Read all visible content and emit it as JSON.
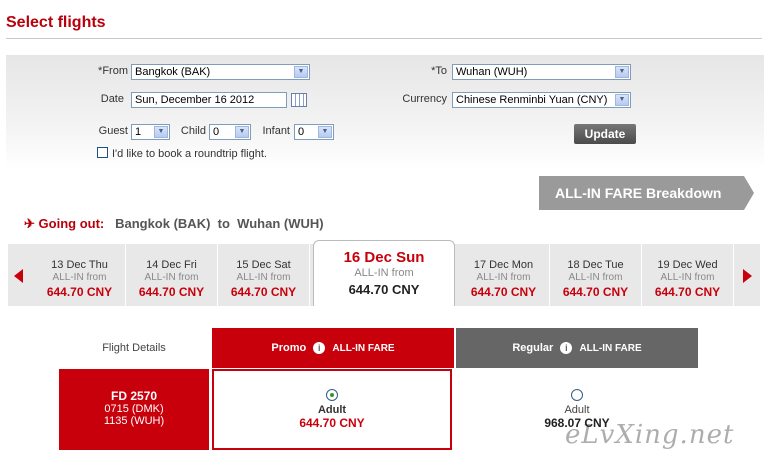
{
  "page": {
    "title": "Select flights"
  },
  "search": {
    "from_label": "*From",
    "from_value": "Bangkok (BAK)",
    "to_label": "*To",
    "to_value": "Wuhan (WUH)",
    "date_label": "Date",
    "date_value": "Sun, December 16 2012",
    "currency_label": "Currency",
    "currency_value": "Chinese Renminbi Yuan (CNY)",
    "guest_label": "Guest",
    "guest_value": "1",
    "child_label": "Child",
    "child_value": "0",
    "infant_label": "Infant",
    "infant_value": "0",
    "roundtrip_label": "I'd like to book a roundtrip flight.",
    "roundtrip_checked": false,
    "update_label": "Update"
  },
  "breakdown_label": "ALL-IN FARE Breakdown",
  "going_out": {
    "label": "Going out:",
    "from": "Bangkok (BAK)",
    "connector": "to",
    "to": "Wuhan (WUH)"
  },
  "date_strip": {
    "days": [
      {
        "date": "13 Dec Thu",
        "sub": "ALL-IN from",
        "price": "644.70 CNY"
      },
      {
        "date": "14 Dec Fri",
        "sub": "ALL-IN from",
        "price": "644.70 CNY"
      },
      {
        "date": "15 Dec Sat",
        "sub": "ALL-IN from",
        "price": "644.70 CNY"
      },
      {
        "date": "16 Dec Sun",
        "sub": "ALL-IN from",
        "price": "644.70 CNY",
        "selected": true
      },
      {
        "date": "17 Dec Mon",
        "sub": "ALL-IN from",
        "price": "644.70 CNY"
      },
      {
        "date": "18 Dec Tue",
        "sub": "ALL-IN from",
        "price": "644.70 CNY"
      },
      {
        "date": "19 Dec Wed",
        "sub": "ALL-IN from",
        "price": "644.70 CNY"
      }
    ]
  },
  "fare_table": {
    "flight_details_label": "Flight Details",
    "promo": {
      "label": "Promo",
      "tag": "ALL-IN FARE"
    },
    "regular": {
      "label": "Regular",
      "tag": "ALL-IN FARE"
    },
    "flight": {
      "number": "FD  2570",
      "depart": "0715  (DMK)",
      "arrive": "1135  (WUH)"
    },
    "promo_fare": {
      "pax": "Adult",
      "price": "644.70 CNY",
      "selected": true
    },
    "regular_fare": {
      "pax": "Adult",
      "price": "968.07 CNY",
      "selected": false
    }
  },
  "colors": {
    "brand_red": "#c8000c",
    "title_red": "#b8000c",
    "regular_gray": "#666666",
    "breakdown_gray": "#9a9a9a"
  },
  "icons": {
    "plane": "plane-icon",
    "info": "info-icon",
    "calendar": "calendar-icon"
  },
  "watermark": "eLvXing.net"
}
